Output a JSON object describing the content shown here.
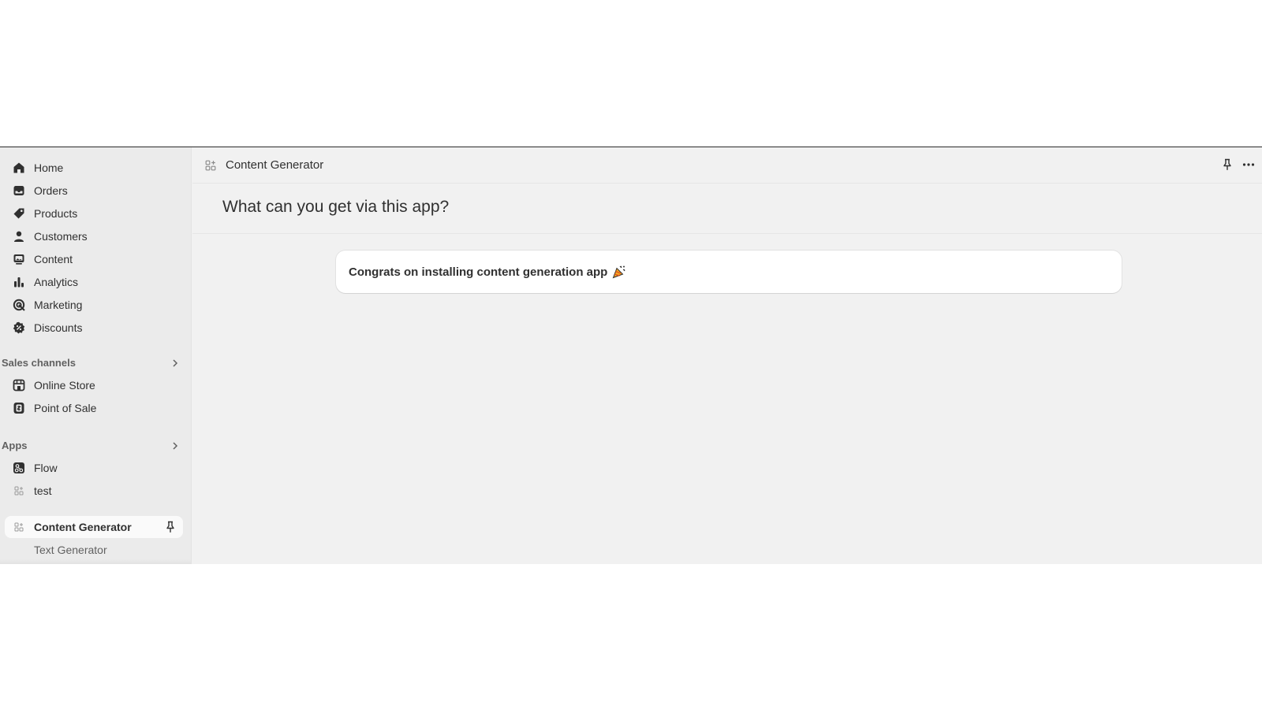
{
  "sidebar": {
    "items": [
      {
        "label": "Home",
        "icon": "home-icon"
      },
      {
        "label": "Orders",
        "icon": "inbox-icon"
      },
      {
        "label": "Products",
        "icon": "tag-icon"
      },
      {
        "label": "Customers",
        "icon": "person-icon"
      },
      {
        "label": "Content",
        "icon": "image-icon"
      },
      {
        "label": "Analytics",
        "icon": "bar-chart-icon"
      },
      {
        "label": "Marketing",
        "icon": "target-icon"
      },
      {
        "label": "Discounts",
        "icon": "discount-icon"
      }
    ],
    "sales_channels": {
      "heading": "Sales channels",
      "items": [
        {
          "label": "Online Store",
          "icon": "store-icon"
        },
        {
          "label": "Point of Sale",
          "icon": "pos-icon"
        }
      ]
    },
    "apps": {
      "heading": "Apps",
      "items": [
        {
          "label": "Flow",
          "icon": "flow-icon"
        },
        {
          "label": "test",
          "icon": "app-grid-icon"
        },
        {
          "label": "Content Generator",
          "icon": "app-grid-icon",
          "active": true
        },
        {
          "label": "Text Generator",
          "icon": ""
        }
      ]
    }
  },
  "topbar": {
    "app_title": "Content Generator"
  },
  "page": {
    "title": "What can you get via this app?",
    "card_text": "Congrats on installing content generation app"
  },
  "colors": {
    "frame_bg": "#f1f1f1",
    "sidebar_bg": "#ebebeb",
    "card_bg": "#ffffff",
    "text": "#303030",
    "muted": "#616161"
  }
}
